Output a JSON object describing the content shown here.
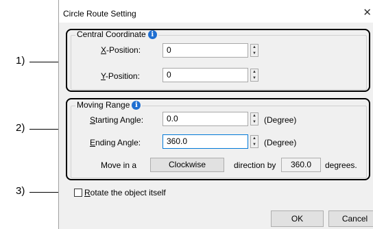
{
  "dialog": {
    "title": "Circle Route Setting",
    "close_glyph": "✕"
  },
  "callouts": [
    "1)",
    "2)",
    "3)"
  ],
  "central_coordinate": {
    "legend": "Central Coordinate",
    "info_glyph": "i",
    "x_label_key": "X",
    "x_label_rest": "-Position:",
    "x_value": "0",
    "y_label_key": "Y",
    "y_label_rest": "-Position:",
    "y_value": "0"
  },
  "moving_range": {
    "legend": "Moving Range",
    "info_glyph": "i",
    "start_label_key": "S",
    "start_label_rest": "tarting Angle:",
    "start_value": "0.0",
    "start_unit": "(Degree)",
    "end_label_key": "E",
    "end_label_rest": "nding Angle:",
    "end_value": "360.0",
    "end_unit": "(Degree)",
    "move_prefix": "Move in a",
    "direction_button": "Clockwise",
    "move_mid": "direction by",
    "degrees_value": "360.0",
    "move_suffix": "degrees."
  },
  "rotate": {
    "label_key": "R",
    "label_rest": "otate the object itself",
    "checked": false
  },
  "buttons": {
    "ok": "OK",
    "cancel": "Cancel"
  },
  "icons": {
    "info": "info-icon",
    "close": "close-icon",
    "spin_up": "spin-up-icon",
    "spin_down": "spin-down-icon"
  }
}
